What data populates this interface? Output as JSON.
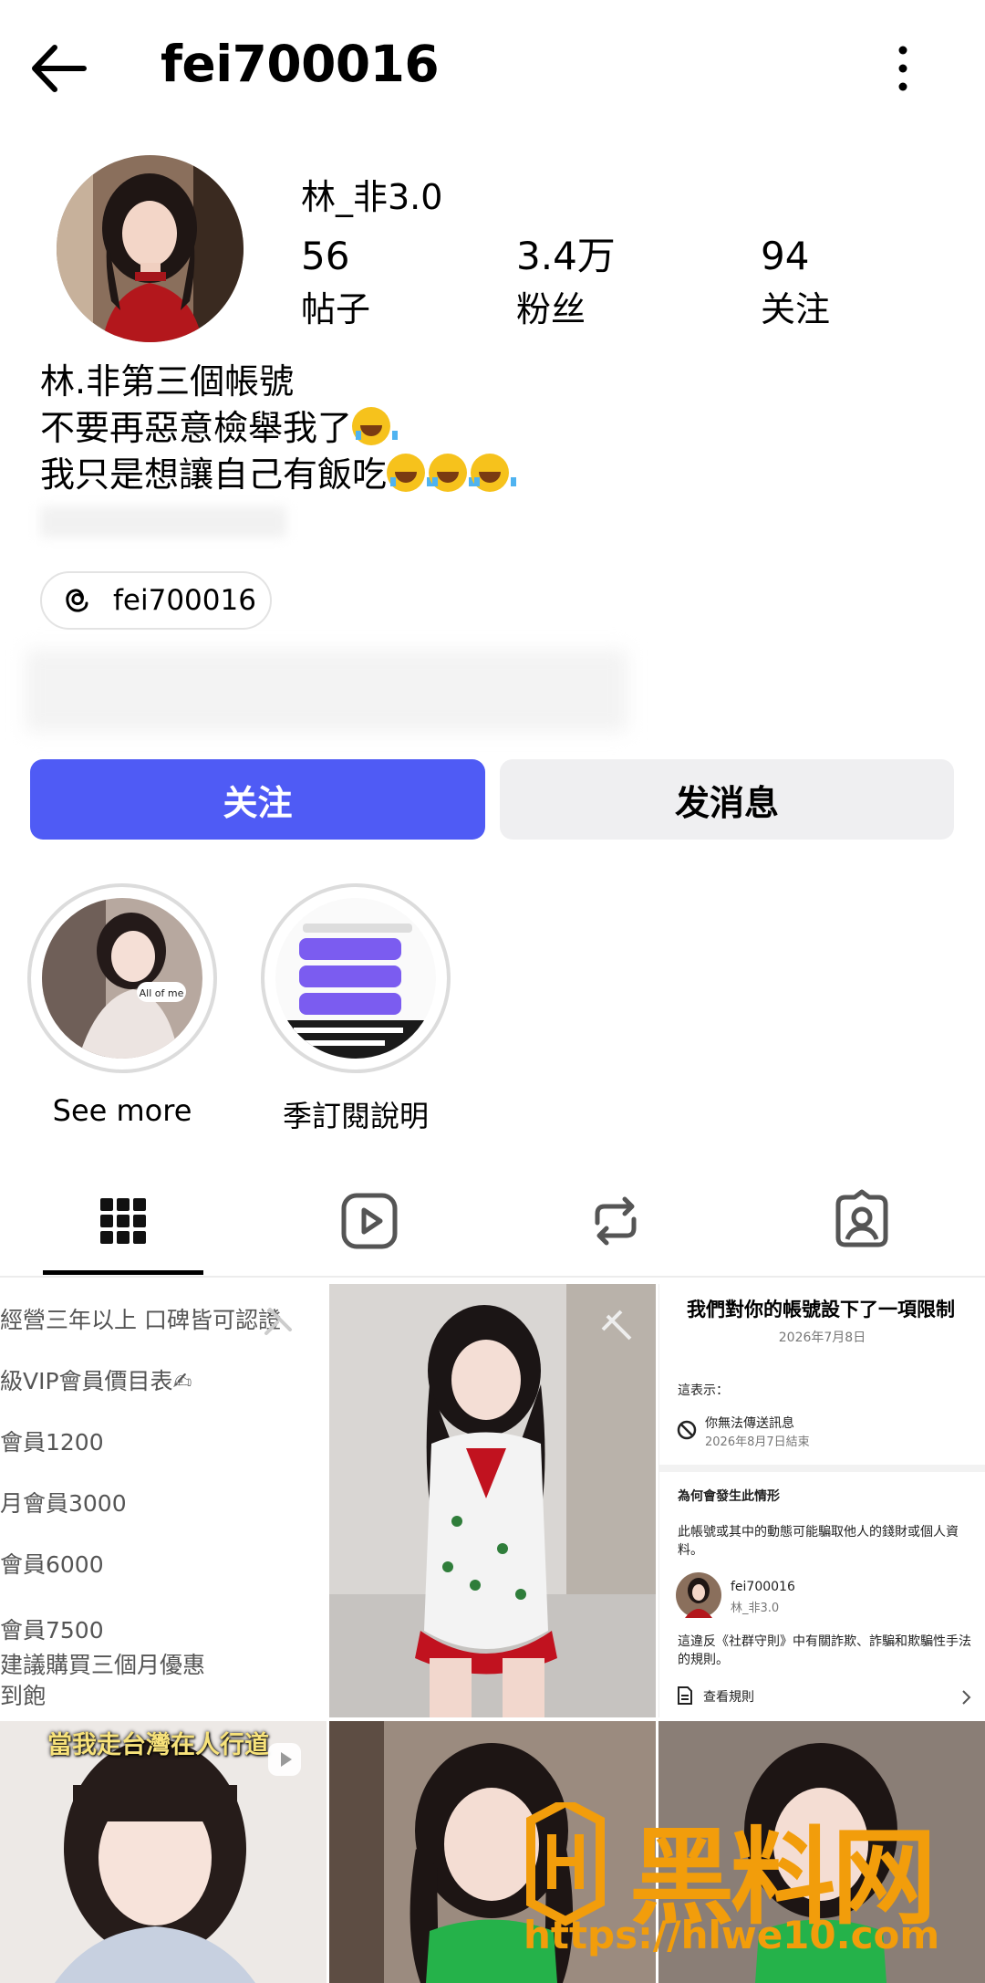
{
  "header": {
    "username": "fei700016"
  },
  "profile": {
    "display_name": "林_非3.0",
    "stats": [
      {
        "value": "56",
        "label": "帖子"
      },
      {
        "value": "3.4万",
        "label": "粉丝"
      },
      {
        "value": "94",
        "label": "关注"
      }
    ],
    "bio": [
      "林.非第三個帳號",
      "不要再惡意檢舉我了",
      "我只是想讓自己有飯吃"
    ],
    "threads_handle": "fei700016"
  },
  "actions": {
    "follow": "关注",
    "message": "发消息"
  },
  "highlights": [
    {
      "label": "See more",
      "sticker": "All of me"
    },
    {
      "label": "季訂閱說明"
    }
  ],
  "grid": {
    "price_card": [
      "經營三年以上 口碑皆可認證",
      "級VIP會員價目表✍",
      "會員1200",
      "月會員3000",
      "會員6000",
      "會員7500",
      "建議購買三個月優惠",
      "到飽"
    ],
    "video_caption": "當我走台灣在人行道",
    "restriction": {
      "title": "我們對你的帳號設下了一項限制",
      "date": "2026年7月8日",
      "means": "這表示：",
      "item": "你無法傳送訊息",
      "item_sub": "2026年8月7日結束",
      "why": "為何會發生此情形",
      "reason": "此帳號或其中的動態可能騙取他人的錢財或個人資料。",
      "account": "fei700016",
      "account_sub": "林_非3.0",
      "rule": "這違反《社群守則》中有關詐欺、詐騙和欺騙性手法的規則。",
      "view": "查看規則"
    }
  },
  "watermark": {
    "text": "黑料网",
    "url": "https://hlwe10.com"
  },
  "colors": {
    "accent": "#4f5bf5",
    "watermark": "#f29d0b"
  }
}
